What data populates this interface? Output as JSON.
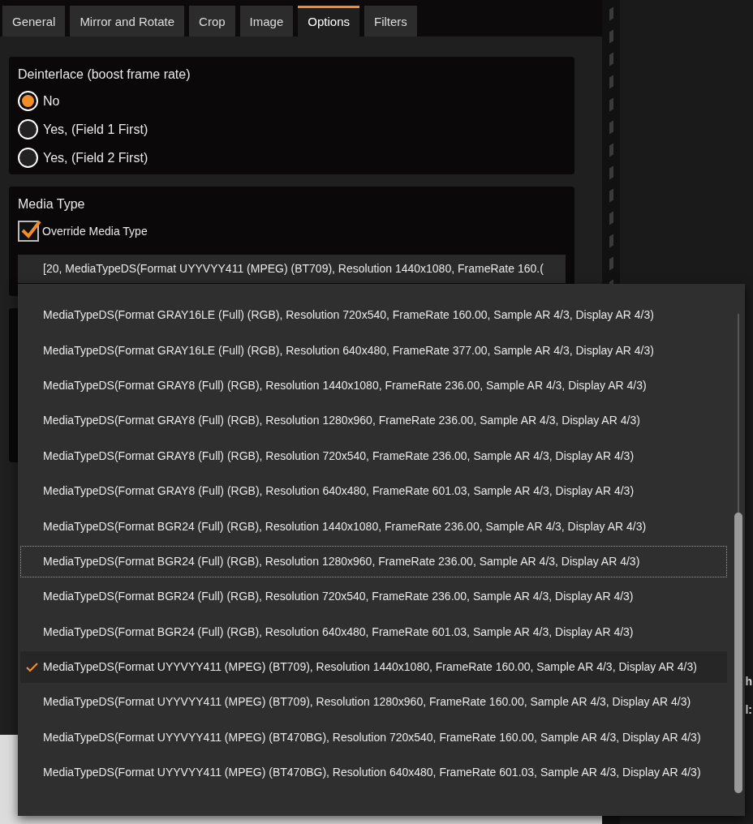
{
  "tabs": [
    {
      "label": "General",
      "selected": false
    },
    {
      "label": "Mirror and Rotate",
      "selected": false
    },
    {
      "label": "Crop",
      "selected": false
    },
    {
      "label": "Image",
      "selected": false
    },
    {
      "label": "Options",
      "selected": true
    },
    {
      "label": "Filters",
      "selected": false
    }
  ],
  "deinterlace": {
    "title": "Deinterlace (boost frame rate)",
    "options": [
      {
        "label": "No",
        "selected": true
      },
      {
        "label": "Yes, (Field 1 First)",
        "selected": false
      },
      {
        "label": "Yes, (Field 2 First)",
        "selected": false
      }
    ]
  },
  "media_type": {
    "title": "Media Type",
    "override": {
      "label": "Override Media Type",
      "checked": true
    },
    "combo_value": "[20, MediaTypeDS(Format UYYVYY411 (MPEG) (BT709), Resolution 1440x1080, FrameRate 160.("
  },
  "dropdown_items": [
    {
      "label": "MediaTypeDS(Format GRAY16LE (Full) (RGB), Resolution 720x540, FrameRate 160.00, Sample AR 4/3, Display AR 4/3)",
      "selected": false,
      "focused": false
    },
    {
      "label": "MediaTypeDS(Format GRAY16LE (Full) (RGB), Resolution 640x480, FrameRate 377.00, Sample AR 4/3, Display AR 4/3)",
      "selected": false,
      "focused": false
    },
    {
      "label": "MediaTypeDS(Format GRAY8 (Full) (RGB), Resolution 1440x1080, FrameRate 236.00, Sample AR 4/3, Display AR 4/3)",
      "selected": false,
      "focused": false
    },
    {
      "label": "MediaTypeDS(Format GRAY8 (Full) (RGB), Resolution 1280x960, FrameRate 236.00, Sample AR 4/3, Display AR 4/3)",
      "selected": false,
      "focused": false
    },
    {
      "label": "MediaTypeDS(Format GRAY8 (Full) (RGB), Resolution 720x540, FrameRate 236.00, Sample AR 4/3, Display AR 4/3)",
      "selected": false,
      "focused": false
    },
    {
      "label": "MediaTypeDS(Format GRAY8 (Full) (RGB), Resolution 640x480, FrameRate 601.03, Sample AR 4/3, Display AR 4/3)",
      "selected": false,
      "focused": false
    },
    {
      "label": "MediaTypeDS(Format BGR24 (Full) (RGB), Resolution 1440x1080, FrameRate 236.00, Sample AR 4/3, Display AR 4/3)",
      "selected": false,
      "focused": false
    },
    {
      "label": "MediaTypeDS(Format BGR24 (Full) (RGB), Resolution 1280x960, FrameRate 236.00, Sample AR 4/3, Display AR 4/3)",
      "selected": false,
      "focused": true
    },
    {
      "label": "MediaTypeDS(Format BGR24 (Full) (RGB), Resolution 720x540, FrameRate 236.00, Sample AR 4/3, Display AR 4/3)",
      "selected": false,
      "focused": false
    },
    {
      "label": "MediaTypeDS(Format BGR24 (Full) (RGB), Resolution 640x480, FrameRate 601.03, Sample AR 4/3, Display AR 4/3)",
      "selected": false,
      "focused": false
    },
    {
      "label": "MediaTypeDS(Format UYYVYY411 (MPEG) (BT709), Resolution 1440x1080, FrameRate 160.00, Sample AR 4/3, Display AR 4/3)",
      "selected": true,
      "focused": false
    },
    {
      "label": "MediaTypeDS(Format UYYVYY411 (MPEG) (BT709), Resolution 1280x960, FrameRate 160.00, Sample AR 4/3, Display AR 4/3)",
      "selected": false,
      "focused": false
    },
    {
      "label": "MediaTypeDS(Format UYYVYY411 (MPEG) (BT470BG), Resolution 720x540, FrameRate 160.00, Sample AR 4/3, Display AR 4/3)",
      "selected": false,
      "focused": false
    },
    {
      "label": "MediaTypeDS(Format UYYVYY411 (MPEG) (BT470BG), Resolution 640x480, FrameRate 601.03, Sample AR 4/3, Display AR 4/3)",
      "selected": false,
      "focused": false
    }
  ],
  "right_panel_fragments": [
    "h",
    "l:"
  ]
}
